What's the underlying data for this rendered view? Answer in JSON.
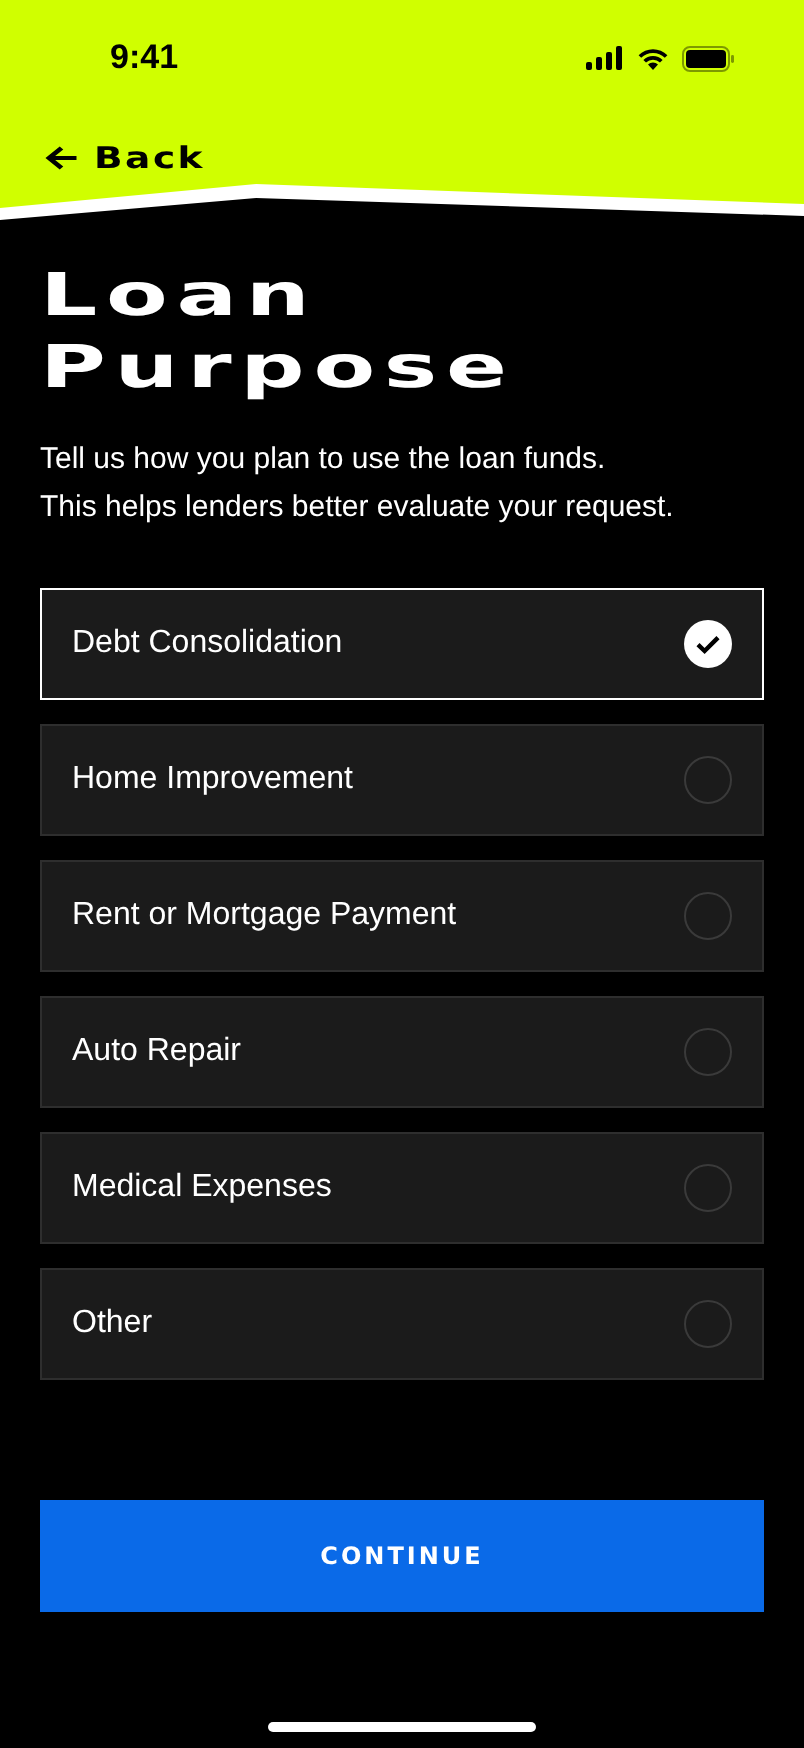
{
  "status_bar": {
    "time": "9:41"
  },
  "nav": {
    "back_label": "Back"
  },
  "title_lines": [
    "Loan",
    "Purpose"
  ],
  "description_lines": [
    "Tell us how you plan to use the loan funds.",
    "This helps lenders better evaluate your request."
  ],
  "options": [
    {
      "label": "Debt Consolidation",
      "selected": true
    },
    {
      "label": "Home Improvement",
      "selected": false
    },
    {
      "label": "Rent or Mortgage Payment",
      "selected": false
    },
    {
      "label": "Auto Repair",
      "selected": false
    },
    {
      "label": "Medical Expenses",
      "selected": false
    },
    {
      "label": "Other",
      "selected": false
    }
  ],
  "continue_button": "CONTINUE"
}
